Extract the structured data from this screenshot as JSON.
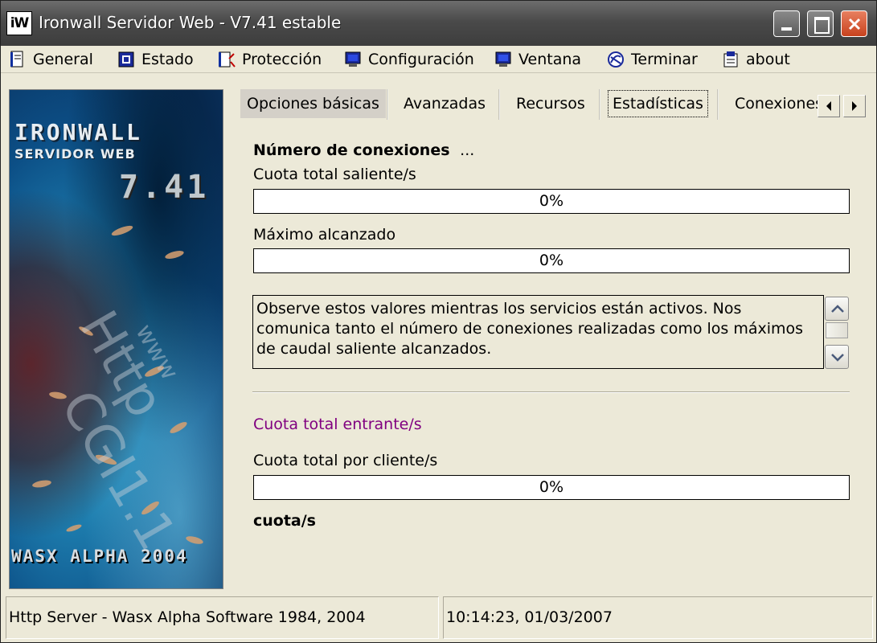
{
  "window": {
    "title": "Ironwall Servidor Web - V7.41 estable",
    "app_icon_text": "iW"
  },
  "menu": {
    "items": [
      {
        "label": "General",
        "icon": "document-icon"
      },
      {
        "label": "Estado",
        "icon": "status-icon"
      },
      {
        "label": "Protección",
        "icon": "protection-icon"
      },
      {
        "label": "Configuración",
        "icon": "monitor-icon"
      },
      {
        "label": "Ventana",
        "icon": "window-icon"
      },
      {
        "label": "Terminar",
        "icon": "exit-icon"
      },
      {
        "label": "about",
        "icon": "about-icon"
      }
    ]
  },
  "banner": {
    "title": "IRONWALL",
    "subtitle": "SERVIDOR WEB",
    "version": "7.41",
    "bottom": "WASX ALPHA 2004"
  },
  "tabs": [
    {
      "label": "Opciones básicas"
    },
    {
      "label": "Avanzadas"
    },
    {
      "label": "Recursos"
    },
    {
      "label": "Estadísticas",
      "selected": true
    },
    {
      "label": "Conexiones"
    }
  ],
  "stats": {
    "connections_heading": "Número de conexiones",
    "connections_value": "...",
    "outgoing_label": "Cuota total saliente/s",
    "outgoing_value": "0%",
    "outgoing_fraction": 0,
    "max_label": "Máximo alcanzado",
    "max_value": "0%",
    "max_fraction": 0,
    "info_text": "Observe estos valores mientras los servicios están activos. Nos comunica tanto el número de conexiones realizadas como los máximos de caudal saliente alcanzados.",
    "incoming_label": "Cuota total entrante/s",
    "incoming_color": "#800080",
    "per_client_label": "Cuota total por cliente/s",
    "per_client_value": "0%",
    "per_client_fraction": 0,
    "quota_unit": "cuota/s"
  },
  "statusbar": {
    "left": "Http Server - Wasx Alpha Software 1984, 2004",
    "right": "10:14:23, 01/03/2007"
  }
}
